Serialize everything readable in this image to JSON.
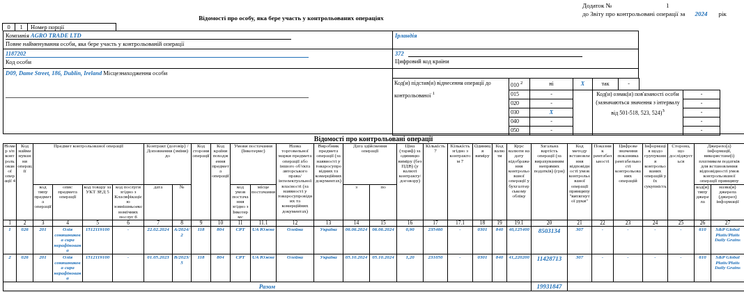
{
  "annex": {
    "label": "Додаток №",
    "number": "1",
    "report": "до Звіту про контрольовані операції за",
    "year": "2024",
    "year_suffix": "рік"
  },
  "title": "Відомості про особу, яка бере участь у контрольованих операціях",
  "portion": {
    "digits": [
      "0",
      "1"
    ],
    "label": "Номер порції"
  },
  "person": {
    "company_label": "Компанія",
    "company": "AGRO TRADE LTD",
    "name_caption": "Повне найменування особи, яка бере участь у контрольованій операції",
    "country": "Ірландія",
    "code": "1187202",
    "code_caption": "Код особи",
    "country_code": "372",
    "country_code_caption": "Цифровий код країни",
    "address": "D09, Dame Street, 186, Dublin, Ireland",
    "address_caption": "Місцезнаходження особи"
  },
  "grounds": {
    "label": "Код(и) підстав(и) віднесення операції до контрольованої $^{1}$",
    "first": {
      "code": "010 $^{2}$",
      "no_label": "ні",
      "no_value": "X",
      "yes_label": "так",
      "yes_value": "-"
    },
    "codes": [
      {
        "code": "015",
        "value": "-"
      },
      {
        "code": "020",
        "value": "-"
      },
      {
        "code": "030",
        "value": "X"
      },
      {
        "code": "040",
        "value": "-"
      },
      {
        "code": "050",
        "value": "-"
      }
    ],
    "relation_label": "Код(и) ознак(и) пов'язаності особи (зазначаються значення з інтервалу від 501-518, 523, 524)$^{3}$",
    "relation_values": [
      "-",
      "-",
      "-",
      "-",
      "-"
    ]
  },
  "operations": {
    "title": "Відомості про контрольовані операції",
    "header": [
      {
        "kind": "column",
        "number": "1",
        "heading": "Номер з/п контрольованої операції 4"
      },
      {
        "kind": "column",
        "number": "2",
        "heading": "Код найменування операції"
      },
      {
        "kind": "group",
        "heading": "Предмет контрольованої операції",
        "columns": [
          {
            "number": "3",
            "heading": "код типу предмета операції"
          },
          {
            "number": "4",
            "heading": "опис предмета операції"
          },
          {
            "number": "5",
            "heading": "код товару за УКТ ЗЕД 5"
          },
          {
            "number": "6",
            "heading": "код послуги згідно з Класифікацією зовнішньоекономічних послуг 6"
          }
        ]
      },
      {
        "kind": "group",
        "heading": "Контракт (договір) / Доповнення (зміни) до",
        "columns": [
          {
            "number": "7",
            "heading": "дата"
          },
          {
            "number": "8",
            "heading": "№"
          }
        ]
      },
      {
        "kind": "column",
        "number": "9",
        "heading": "Код сторони операції"
      },
      {
        "kind": "column",
        "number": "10",
        "heading": "Код країни походження предмета операції"
      },
      {
        "kind": "group",
        "heading": "Умови постачання (Інкотермс)",
        "columns": [
          {
            "number": "11",
            "heading": "код умов постачання згідно з Інкотермс"
          },
          {
            "number": "11.1",
            "heading": "місце постачання"
          }
        ]
      },
      {
        "kind": "column",
        "number": "12",
        "heading": "Назва торговельної марки предмета операції або іншого об'єкта авторського права/інтелектуальної власності (за наявності у товаросупровідних та комерційних документах)"
      },
      {
        "kind": "column",
        "number": "13",
        "heading": "Виробник предмета операції (за наявності у товаросупровідних та комерційних документах)"
      },
      {
        "kind": "group",
        "heading": "Дата здійснення операції",
        "columns": [
          {
            "number": "14",
            "heading": "з"
          },
          {
            "number": "15",
            "heading": "по"
          }
        ]
      },
      {
        "kind": "column",
        "number": "16",
        "heading": "Ціна (тариф) за одиницю виміру (без ПДВ) (у валюті контракту/ договору)"
      },
      {
        "kind": "column",
        "number": "17",
        "heading": "Кількість 7"
      },
      {
        "kind": "column",
        "number": "17.1",
        "heading": "Кількість згідно з контрактом 7"
      },
      {
        "kind": "column",
        "number": "18",
        "heading": "Одиниця виміру"
      },
      {
        "kind": "column",
        "number": "19",
        "heading": "Код валюти"
      },
      {
        "kind": "column",
        "number": "19.1",
        "heading": "Курс валюти на дату відображення контрольованої операції у бухгалтерському обліку"
      },
      {
        "kind": "column",
        "number": "20",
        "heading": "Загальна вартість операції (за вирахуванням непрямих податків) (грн)"
      },
      {
        "kind": "column",
        "number": "21",
        "heading": "Код методу встановлення відповідності умов контрольованої операції принципу \"витягнутої руки\""
      },
      {
        "kind": "column",
        "number": "22",
        "heading": "Показник рентабельності"
      },
      {
        "kind": "column",
        "number": "23",
        "heading": "Цифрове значення показника рентабельності контрольованих операцій"
      },
      {
        "kind": "column",
        "number": "24",
        "heading": "Інформація щодо групування контрольованих операцій у їх сукупність"
      },
      {
        "kind": "column",
        "number": "25",
        "heading": "Сторона, що досліджується"
      },
      {
        "kind": "group",
        "heading": "Джерело(а) інформації, використане(і) платником податків для встановлення відповідності умов контрольованої операції принципу",
        "columns": [
          {
            "number": "26",
            "heading": "код(и) типу джерела"
          },
          {
            "number": "27",
            "heading": "назва(и) джерела (джерел) інформації"
          }
        ]
      }
    ],
    "rows": [
      {
        "cells": [
          "1",
          "026",
          "201",
          "Олія соняшникова сира нерафінована",
          "1512119100",
          "-",
          "22.02.2024",
          "A/2024/2",
          "118",
          "804",
          "CPT",
          "UA Южне",
          "Олейна",
          "Україна",
          "06.06.2024",
          "06.06.2024",
          "0,90",
          "235460",
          "-",
          "0301",
          "840",
          "40,125400",
          "8503134",
          "307",
          "-",
          "-",
          "-",
          "-",
          "610",
          "S&P Global Platts/Platts Daily Grains"
        ]
      },
      {
        "cells": [
          "2",
          "026",
          "201",
          "Олія соняшникова сира нерафінована",
          "1512119100",
          "-",
          "01.05.2023",
          "B/2023/5",
          "118",
          "804",
          "CPT",
          "UA Южне",
          "Олейна",
          "Україна",
          "05.10.2024",
          "05.10.2024",
          "1,20",
          "231050",
          "-",
          "0301",
          "840",
          "41,220200",
          "11428713",
          "307",
          "-",
          "-",
          "-",
          "-",
          "610",
          "S&P Global Platts/Platts Daily Grains"
        ]
      }
    ],
    "total": {
      "label": "Разом",
      "value": "19931847"
    }
  }
}
